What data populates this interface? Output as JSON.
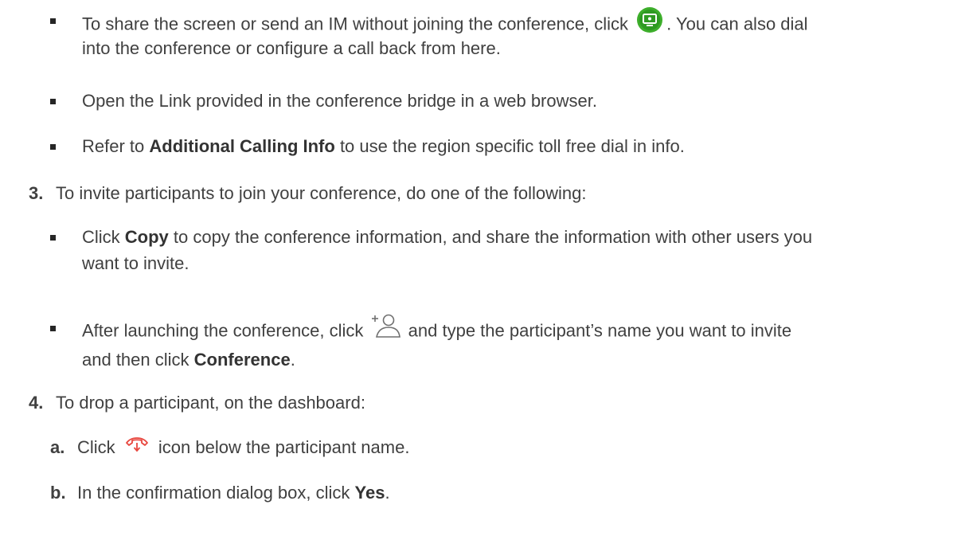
{
  "bullets": {
    "share_line1_before": "To share the screen or send an IM without joining the conference, click",
    "share_line1_after": ". You can also dial",
    "share_line2": "into the conference or configure a call back from here.",
    "open_link": "Open the Link provided in the conference bridge in a web browser.",
    "refer_prefix": "Refer to",
    "refer_bold": "Additional Calling Info",
    "refer_suffix": "to use the region specific toll free dial in info."
  },
  "step3": {
    "number": "3.",
    "text": "To invite participants to join your conference, do one of the following:",
    "copy_prefix": "Click",
    "copy_bold": "Copy",
    "copy_suffix": "to copy the conference information, and share the information with other users you",
    "copy_line2": "want to invite.",
    "after_before": "After launching the conference, click",
    "after_after": "and type the participant’s name you want to invite",
    "after_line2_prefix": "and then click",
    "after_line2_bold": "Conference",
    "after_line2_suffix": "."
  },
  "step4": {
    "number": "4.",
    "text": "To drop a participant, on the dashboard:",
    "a_label": "a.",
    "a_prefix": "Click",
    "a_suffix": "icon below the participant name.",
    "b_label": "b.",
    "b_prefix": "In the confirmation dialog box, click",
    "b_bold": "Yes",
    "b_suffix": "."
  },
  "icons": {
    "share_icon": "screen-share-icon",
    "share_color": "#3dae2b",
    "add_participant_icon": "add-participant-icon",
    "hangup_icon": "hang-up-icon",
    "hangup_color": "#e8463e"
  }
}
